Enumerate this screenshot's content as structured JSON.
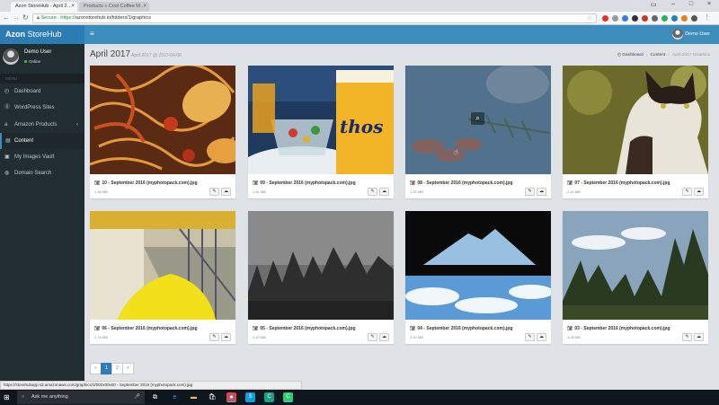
{
  "browser": {
    "tabs": [
      {
        "label": "Azon StoreHub - April 2…",
        "active": true
      },
      {
        "label": "Products « Cool Coffee M…",
        "active": false
      }
    ],
    "secure_label": "Secure",
    "url_scheme": "https://",
    "url_rest": "azonstorehub.io/folders/1/graphics",
    "back_icon": "arrow-left-icon",
    "status_url": "https://storehubapp.s3.amazonaws.com/graphics/1/000x00x00 - September 2016 (myphotopack.com).jpg"
  },
  "app": {
    "brand_bold": "Azon",
    "brand_rest": " StoreHub",
    "user_name": "Demo User",
    "user_status": "Online",
    "menu_header": "MENU",
    "menu": [
      {
        "label": "Dashboard",
        "icon": "dashboard-icon",
        "glyph": "◴",
        "active": false,
        "has_children": false
      },
      {
        "label": "WordPress Sites",
        "icon": "wordpress-icon",
        "glyph": "⓪",
        "active": false,
        "has_children": false
      },
      {
        "label": "Amazon Products",
        "icon": "amazon-icon",
        "glyph": "a",
        "active": false,
        "has_children": true
      },
      {
        "label": "Content",
        "icon": "content-icon",
        "glyph": "▤",
        "active": true,
        "has_children": false
      },
      {
        "label": "My Images Vault",
        "icon": "images-icon",
        "glyph": "▣",
        "active": false,
        "has_children": false
      },
      {
        "label": "Domain Search",
        "icon": "globe-icon",
        "glyph": "◍",
        "active": false,
        "has_children": false
      }
    ],
    "topbar_user": "Demo User"
  },
  "page": {
    "title": "April 2017",
    "subtitle": "April 2017 @ 2017-04-06",
    "breadcrumb": [
      "Dashboard",
      "Content",
      "April 2017 Graphics"
    ]
  },
  "images": [
    {
      "name": "10 - September 2016 (myphotopack.com).jpg",
      "size": "1.38 MB",
      "scene": "food"
    },
    {
      "name": "09 - September 2016 (myphotopack.com).jpg",
      "size": "1.61 MB",
      "scene": "beer"
    },
    {
      "name": "08 - September 2016 (myphotopack.com).jpg",
      "size": "1.32 MB",
      "scene": "herbs"
    },
    {
      "name": "07 - September 2016 (myphotopack.com).jpg",
      "size": "2.42 MB",
      "scene": "cat"
    },
    {
      "name": "06 - September 2016 (myphotopack.com).jpg",
      "size": "2.78 MB",
      "scene": "stairs"
    },
    {
      "name": "05 - September 2016 (myphotopack.com).jpg",
      "size": "2.19 MB",
      "scene": "forest"
    },
    {
      "name": "04 - September 2016 (myphotopack.com).jpg",
      "size": "2.42 MB",
      "scene": "clouds"
    },
    {
      "name": "03 - September 2016 (myphotopack.com).jpg",
      "size": "3.28 MB",
      "scene": "trees"
    }
  ],
  "pagination": [
    "«",
    "1",
    "2",
    "»"
  ],
  "pagination_active": 1,
  "taskbar": {
    "search_placeholder": "Ask me anything"
  }
}
